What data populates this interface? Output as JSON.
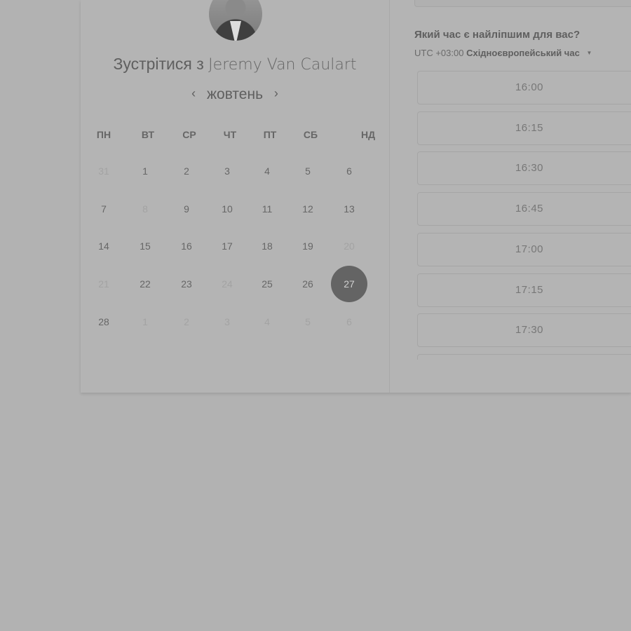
{
  "host": {
    "title_prefix": "Зустрітися з",
    "name": "Jeremy Van Caulart"
  },
  "calendar": {
    "month": "жовтень",
    "prev_icon": "chevron-left-icon",
    "next_icon": "chevron-right-icon",
    "weekdays": [
      "ПН",
      "ВТ",
      "СР",
      "ЧТ",
      "ПТ",
      "СБ",
      "НД"
    ],
    "weeks": [
      [
        {
          "d": "31",
          "m": true
        },
        {
          "d": "1"
        },
        {
          "d": "2"
        },
        {
          "d": "3"
        },
        {
          "d": "4"
        },
        {
          "d": "5"
        },
        {
          "d": "6"
        }
      ],
      [
        {
          "d": "7"
        },
        {
          "d": "8",
          "m": true
        },
        {
          "d": "9"
        },
        {
          "d": "10"
        },
        {
          "d": "11"
        },
        {
          "d": "12"
        },
        {
          "d": "13"
        }
      ],
      [
        {
          "d": "14"
        },
        {
          "d": "15"
        },
        {
          "d": "16"
        },
        {
          "d": "17"
        },
        {
          "d": "18"
        },
        {
          "d": "19"
        },
        {
          "d": "20",
          "m": true
        }
      ],
      [
        {
          "d": "21",
          "m": true
        },
        {
          "d": "22"
        },
        {
          "d": "23"
        },
        {
          "d": "24",
          "m": true
        },
        {
          "d": "25"
        },
        {
          "d": "26"
        },
        {
          "d": "27",
          "s": true
        }
      ],
      [
        {
          "d": "28"
        },
        {
          "d": "1",
          "m": true
        },
        {
          "d": "2",
          "m": true
        },
        {
          "d": "3",
          "m": true
        },
        {
          "d": "4",
          "m": true
        },
        {
          "d": "5",
          "m": true
        },
        {
          "d": "6",
          "m": true
        }
      ]
    ],
    "selected_color": "#646464"
  },
  "times": {
    "question": "Який час є найліпшим для вас?",
    "tz_offset": "UTC +03:00",
    "tz_name": "Східноєвропейський час",
    "tz_dropdown_icon": "caret-down-icon",
    "slots": [
      "16:00",
      "16:15",
      "16:30",
      "16:45",
      "17:00",
      "17:15",
      "17:30"
    ]
  }
}
